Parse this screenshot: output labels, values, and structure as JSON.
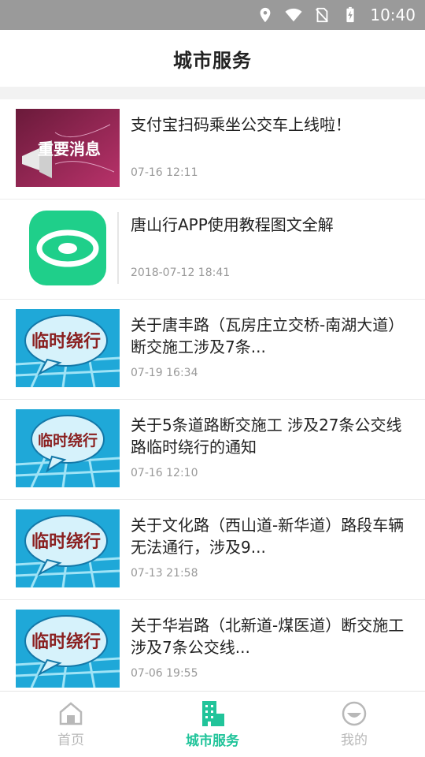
{
  "status": {
    "time": "10:40"
  },
  "header": {
    "title": "城市服务"
  },
  "news": [
    {
      "title": "支付宝扫码乘坐公交车上线啦！",
      "date": "07-16 12:11",
      "thumb_text": "重要消息",
      "thumb_type": "announcement"
    },
    {
      "title": "唐山行APP使用教程图文全解",
      "date": "2018-07-12 18:41",
      "thumb_text": "",
      "thumb_type": "app-logo"
    },
    {
      "title": "关于唐丰路（瓦房庄立交桥-南湖大道）断交施工涉及7条...",
      "date": "07-19 16:34",
      "thumb_text": "临时绕行",
      "thumb_type": "detour"
    },
    {
      "title": "关于5条道路断交施工 涉及27条公交线路临时绕行的通知",
      "date": "07-16 12:10",
      "thumb_text": "临时绕行",
      "thumb_type": "detour"
    },
    {
      "title": "关于文化路（西山道-新华道）路段车辆无法通行，涉及9...",
      "date": "07-13 21:58",
      "thumb_text": "临时绕行",
      "thumb_type": "detour"
    },
    {
      "title": "关于华岩路（北新道-煤医道）断交施工 涉及7条公交线...",
      "date": "07-06 19:55",
      "thumb_text": "临时绕行",
      "thumb_type": "detour"
    }
  ],
  "bottom_nav": [
    {
      "label": "首页",
      "icon": "home-icon",
      "active": false
    },
    {
      "label": "城市服务",
      "icon": "city-services-icon",
      "active": true
    },
    {
      "label": "我的",
      "icon": "profile-icon",
      "active": false
    }
  ],
  "colors": {
    "accent": "#21c49a",
    "statusbar": "#9a9a9a",
    "inactive": "#b8b8b8"
  }
}
